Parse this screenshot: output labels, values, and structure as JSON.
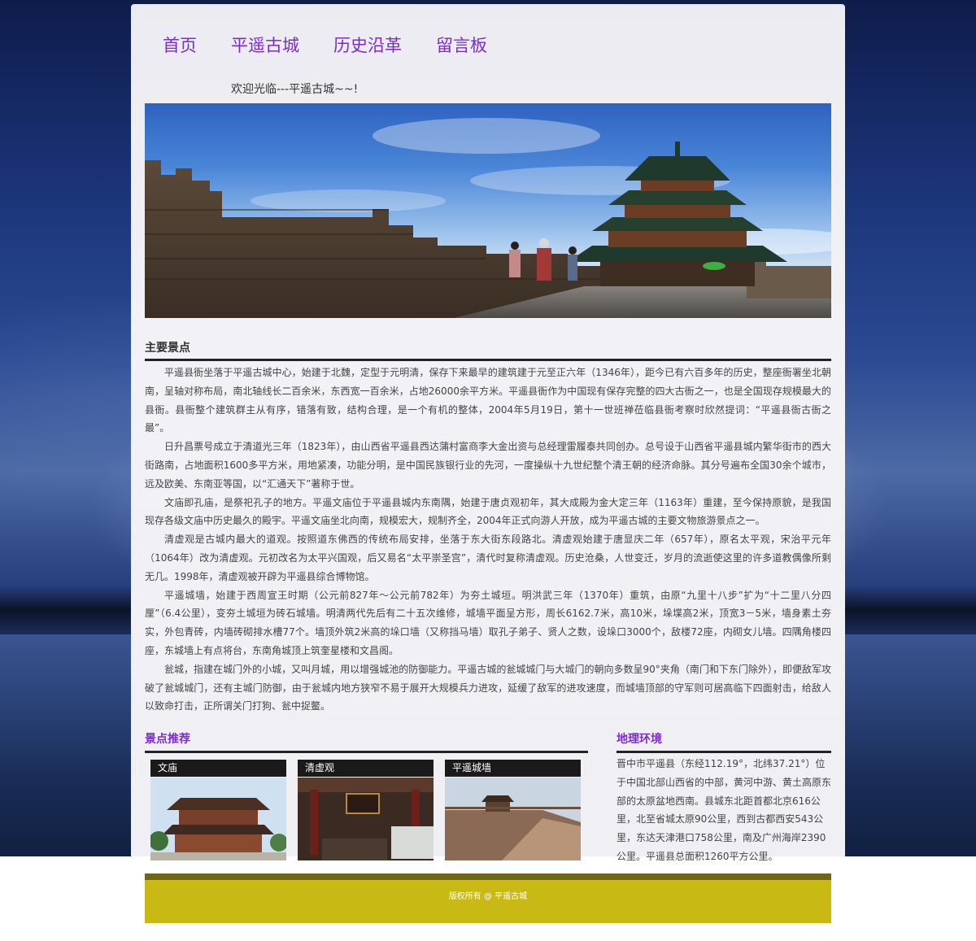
{
  "nav": {
    "items": [
      {
        "label": "首页"
      },
      {
        "label": "平遥古城"
      },
      {
        "label": "历史沿革"
      },
      {
        "label": "留言板"
      }
    ]
  },
  "welcome": "欢迎光临---平遥古城~~!",
  "main": {
    "title": "主要景点",
    "paragraphs": [
      "平遥县衙坐落于平遥古城中心，始建于北魏，定型于元明清，保存下来最早的建筑建于元至正六年（1346年），距今已有六百多年的历史，整座衙署坐北朝南，呈轴对称布局，南北轴线长二百余米，东西宽一百余米，占地26000余平方米。平遥县衙作为中国现有保存完整的四大古衙之一，也是全国现存规模最大的县衙。县衙整个建筑群主从有序，错落有致，结构合理，是一个有机的整体，2004年5月19日，第十一世班禅莅临县衙考察时欣然提词：“平遥县衙古衙之最”。",
      "日升昌票号成立于清道光三年（1823年），由山西省平遥县西达蒲村富商李大金出资与总经理雷履泰共同创办。总号设于山西省平遥县城内繁华街市的西大街路南，占地面积1600多平方米，用地紧凑，功能分明，是中国民族银行业的先河，一度操纵十九世纪整个清王朝的经济命脉。其分号遍布全国30余个城市，远及欧美、东南亚等国，以“汇通天下”著称于世。",
      "文庙即孔庙，是祭祀孔子的地方。平遥文庙位于平遥县城内东南隅，始建于唐贞观初年，其大成殿为金大定三年（1163年）重建，至今保持原貌，是我国现存各级文庙中历史最久的殿宇。平遥文庙坐北向南，规模宏大，规制齐全，2004年正式向游人开放，成为平遥古城的主要文物旅游景点之一。",
      "清虚观是古城内最大的道观。按照道东佛西的传统布局安排，坐落于东大街东段路北。清虚观始建于唐显庆二年（657年），原名太平观，宋治平元年（1064年）改为清虚观。元初改名为太平兴国观，后又易名“太平崇圣宫”，清代时复称清虚观。历史沧桑，人世变迁，岁月的流逝使这里的许多道教偶像所剩无几。1998年，清虚观被开辟为平遥县综合博物馆。",
      "平遥城墙，始建于西周宣王时期（公元前827年～公元前782年）为夯土城垣。明洪武三年（1370年）重筑，由原“九里十八步”扩为“十二里八分四厘”（6.4公里），变夯土城垣为砖石城墙。明清两代先后有二十五次维修，城墙平面呈方形，周长6162.7米，高10米，垛堞高2米，顶宽3－5米，墙身素土夯实，外包青砖，内墙砖砌排水槽77个。墙顶外筑2米高的垛口墙（又称挡马墙）取孔子弟子、贤人之数，设垛口3000个，敌楼72座，内砌女儿墙。四隅角楼四座，东城墙上有点将台，东南角城顶上筑奎星楼和文昌阁。",
      "瓮城，指建在城门外的小城，又叫月城，用以增强城池的防御能力。平遥古城的瓮城城门与大城门的朝向多数呈90°夹角（南门和下东门除外），即便敌军攻破了瓮城城门，还有主城门防御，由于瓮城内地方狭窄不易于展开大规模兵力进攻，延缓了敌军的进攻速度，而城墙顶部的守军则可居高临下四面射击，给敌人以致命打击，正所谓关门打狗、瓮中捉鳖。"
    ]
  },
  "recommend": {
    "title": "景点推荐",
    "cards": [
      {
        "caption": "文庙"
      },
      {
        "caption": "清虚观"
      },
      {
        "caption": "平遥城墙"
      }
    ]
  },
  "geo": {
    "title": "地理环境",
    "text": "晋中市平遥县（东经112.19°，北纬37.21°）位于中国北部山西省的中部，黄河中游、黄土高原东部的太原盆地西南。县城东北距首都北京616公里，北至省城太原90公里，西到古都西安543公里，东达天津港口758公里，南及广州海岸2390公里。平遥县总面积1260平方公里。"
  },
  "footer": {
    "text": "版权所有 @ 平遥古城"
  },
  "colors": {
    "nav": "#7b2bd0",
    "section_accent": "#7b2bd0",
    "footer_bg": "#c9b915",
    "footer_top_bar": "#6e661a"
  }
}
